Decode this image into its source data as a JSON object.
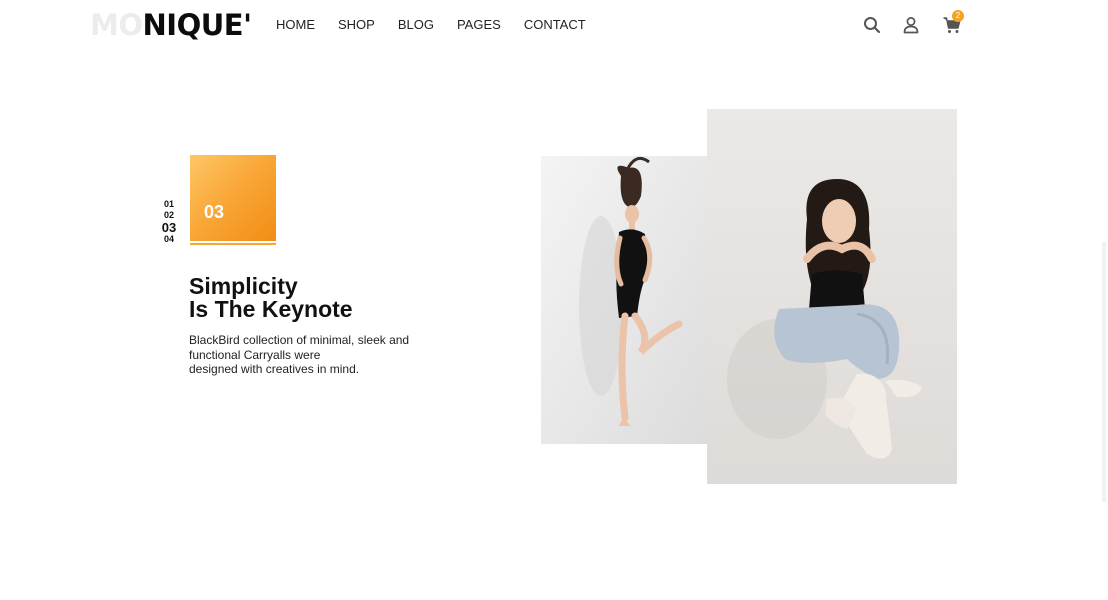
{
  "header": {
    "logo_faded": "MO",
    "logo_solid": "NIQUE'",
    "nav": [
      "HOME",
      "SHOP",
      "BLOG",
      "PAGES",
      "CONTACT"
    ],
    "icons": [
      "search-icon",
      "user-icon",
      "cart-icon"
    ],
    "cart_count": "2"
  },
  "slider": {
    "counter": [
      "01",
      "02",
      "03",
      "04"
    ],
    "active_index": 2,
    "active_number": "03",
    "headline_line1": "Simplicity",
    "headline_line2": "Is The Keynote",
    "description_line1": "BlackBird collection of minimal, sleek and",
    "description_line2": "functional Carryalls were",
    "description_line3": "designed with creatives in mind."
  },
  "colors": {
    "accent": "#f7a632",
    "text": "#111111",
    "background": "#ffffff"
  }
}
